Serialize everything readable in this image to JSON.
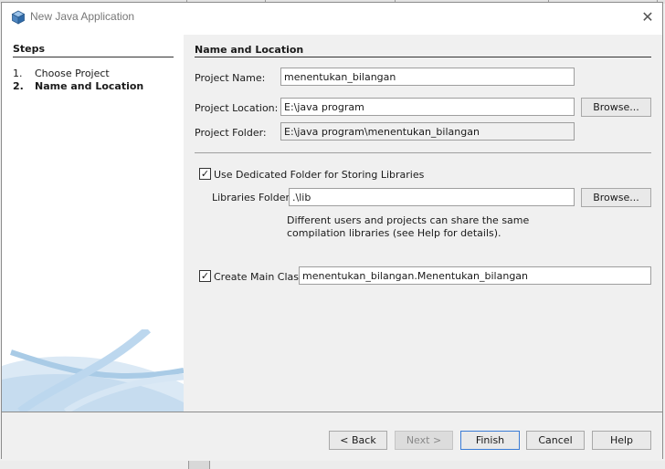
{
  "window": {
    "title": "New Java Application"
  },
  "steps": {
    "title": "Steps",
    "items": [
      {
        "num": "1.",
        "label": "Choose Project",
        "active": false
      },
      {
        "num": "2.",
        "label": "Name and Location",
        "active": true
      }
    ]
  },
  "panel": {
    "title": "Name and Location",
    "project_name": {
      "label": "Project Name:",
      "value": "menentukan_bilangan"
    },
    "project_location": {
      "label": "Project Location:",
      "value": "E:\\java program",
      "browse": "Browse..."
    },
    "project_folder": {
      "label": "Project Folder:",
      "value": "E:\\java program\\menentukan_bilangan"
    },
    "dedicated_folder": {
      "label": "Use Dedicated Folder for Storing Libraries",
      "checked": true
    },
    "libraries_folder": {
      "label": "Libraries Folder:",
      "value": ".\\lib",
      "browse": "Browse..."
    },
    "note": "Different users and projects can share the same compilation libraries (see Help for details).",
    "main_class": {
      "label": "Create Main Class",
      "checked": true,
      "value": "menentukan_bilangan.Menentukan_bilangan"
    }
  },
  "footer": {
    "back": "< Back",
    "next": "Next >",
    "finish": "Finish",
    "cancel": "Cancel",
    "help": "Help"
  },
  "colors": {
    "accent": "#3a7bd5",
    "dialog_bg": "#f0f0f0",
    "swoosh": "#a9cbe6"
  }
}
